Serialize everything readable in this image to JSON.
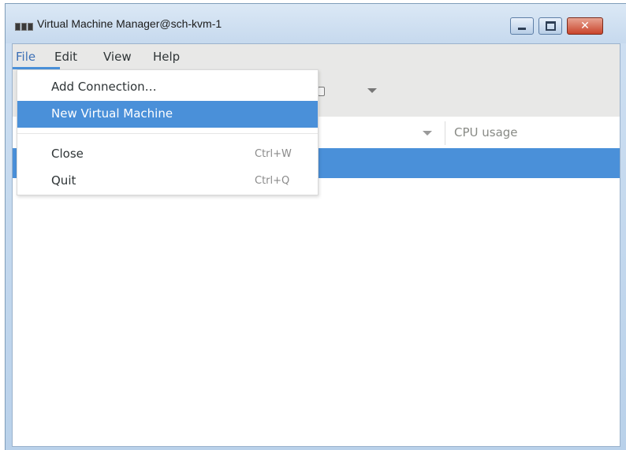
{
  "window": {
    "title": "Virtual Machine Manager@sch-kvm-1",
    "icon": "vm-manager-app-icon",
    "controls": {
      "minimize_icon": "minimize-icon",
      "maximize_icon": "maximize-icon",
      "close_glyph": "✕"
    }
  },
  "menubar": {
    "items": [
      {
        "label": "File",
        "active": true
      },
      {
        "label": "Edit"
      },
      {
        "label": "View"
      },
      {
        "label": "Help"
      }
    ]
  },
  "file_menu": {
    "items": [
      {
        "label": "Add Connection…",
        "shortcut": ""
      },
      {
        "label": "New Virtual Machine",
        "shortcut": "",
        "highlighted": true
      },
      {
        "label": "Close",
        "shortcut": "Ctrl+W"
      },
      {
        "label": "Quit",
        "shortcut": "Ctrl+Q"
      }
    ]
  },
  "toolbar": {
    "icons": [
      "vm-icon",
      "chevron-down-icon"
    ]
  },
  "vm_list": {
    "columns": [
      {
        "label": "CPU usage"
      }
    ],
    "selected_row": true
  },
  "colors": {
    "accent": "#4a90d9",
    "menubar_bg": "#e8e8e7",
    "titlebar_bg": "#c6d9ee",
    "close_button": "#c9442b"
  }
}
